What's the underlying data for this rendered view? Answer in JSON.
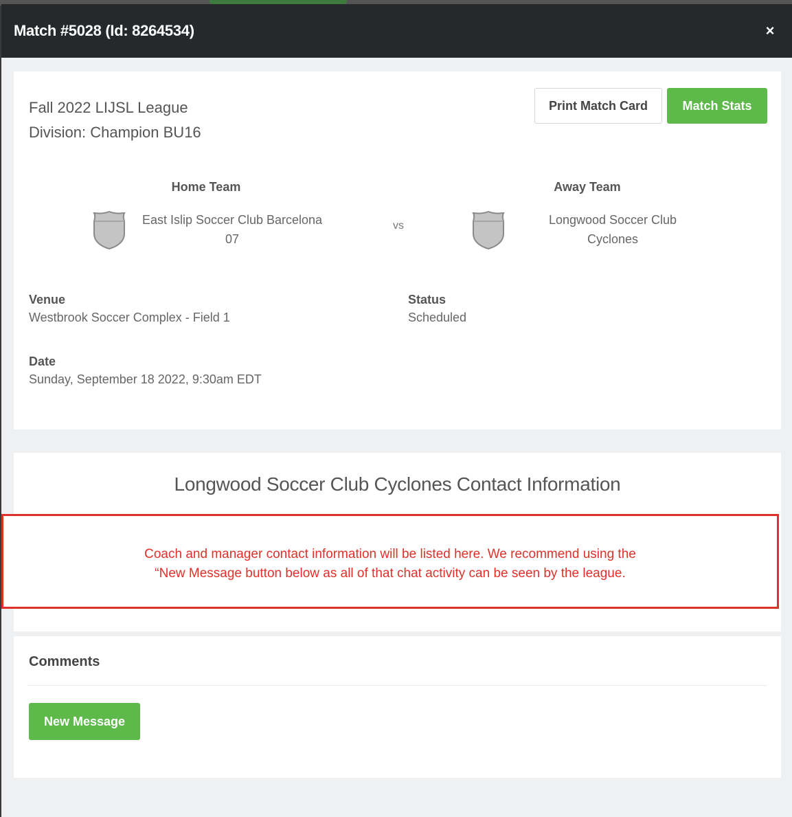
{
  "modal": {
    "title": "Match #5028 (Id: 8264534)",
    "close_symbol": "×"
  },
  "match": {
    "league": "Fall 2022 LIJSL League",
    "division": "Division: Champion BU16",
    "print_label": "Print Match Card",
    "stats_label": "Match Stats",
    "home_heading": "Home Team",
    "away_heading": "Away Team",
    "home_name_line1": "East Islip Soccer Club Barcelona",
    "home_name_line2": "07",
    "away_name_line1": "Longwood Soccer Club",
    "away_name_line2": "Cyclones",
    "vs_label": "vs",
    "venue_label": "Venue",
    "venue_value": "Westbrook Soccer Complex - Field 1",
    "status_label": "Status",
    "status_value": "Scheduled",
    "date_label": "Date",
    "date_value": "Sunday, September 18 2022, 9:30am EDT"
  },
  "contact": {
    "title": "Longwood Soccer Club Cyclones Contact Information",
    "note_line1": "Coach and manager contact information will be listed here. We recommend using the",
    "note_line2": "“New Message button below as all of that chat activity can be seen by the league."
  },
  "comments": {
    "title": "Comments",
    "new_message_label": "New Message"
  },
  "icons": {
    "team_crest": "shield-icon",
    "close": "close-icon"
  },
  "colors": {
    "header_bg": "#26292b",
    "accent_green": "#5cb94a",
    "annotation_red": "#e0302a"
  }
}
